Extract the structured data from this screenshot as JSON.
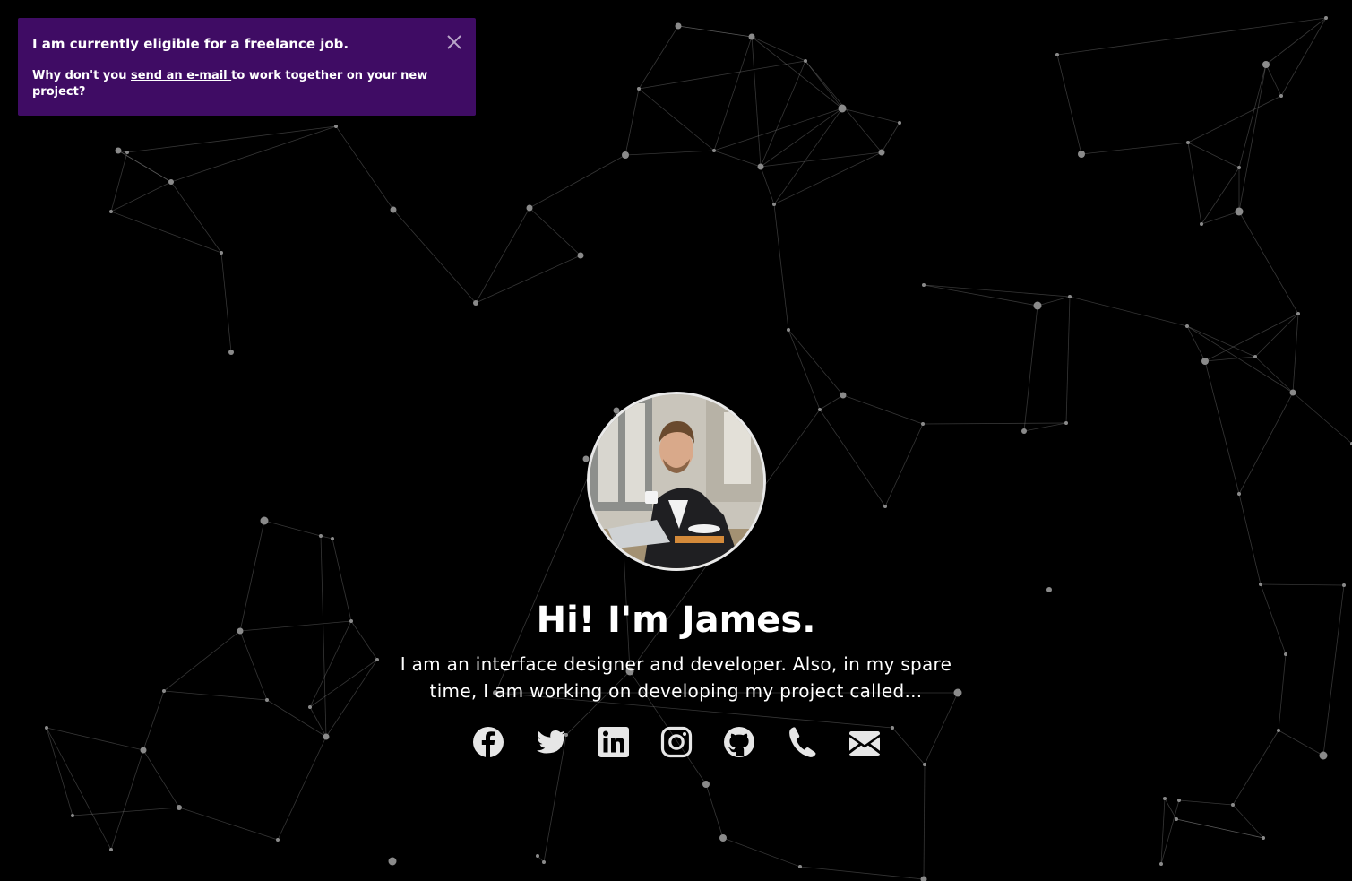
{
  "notice": {
    "title": "I am currently eligible for a freelance job.",
    "text_before": "Why don't you ",
    "link_text": "send an e-mail ",
    "text_after": "to work together on your new project?",
    "close_icon": "close-icon",
    "background": "#3f0c64"
  },
  "hero": {
    "title": "Hi! I'm James.",
    "subtitle": "I am an interface designer and developer. Also, in my spare time, I am working on developing my project called..."
  },
  "socials": [
    {
      "name": "facebook",
      "icon": "facebook-icon"
    },
    {
      "name": "twitter",
      "icon": "twitter-icon"
    },
    {
      "name": "linkedin",
      "icon": "linkedin-icon"
    },
    {
      "name": "instagram",
      "icon": "instagram-icon"
    },
    {
      "name": "github",
      "icon": "github-icon"
    },
    {
      "name": "phone",
      "icon": "phone-icon"
    },
    {
      "name": "email",
      "icon": "mail-icon"
    }
  ],
  "colors": {
    "background": "#000000",
    "icon": "#e6e6e6",
    "network_line": "#9a9a9a",
    "network_node": "#8a8a8a"
  }
}
